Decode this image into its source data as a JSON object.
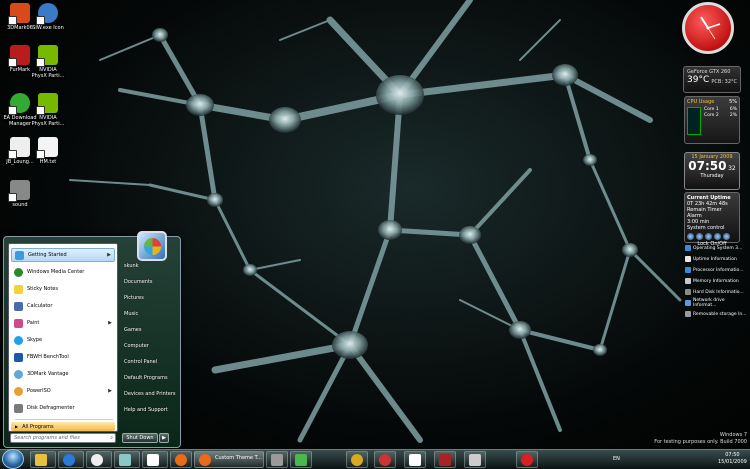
{
  "desktop": {
    "icons": [
      {
        "label": "3DMark06",
        "color": "#d84a1a"
      },
      {
        "label": "SIW.exe Icon",
        "color": "#3a7ac8"
      },
      {
        "label": "FurMark",
        "color": "#b81c1c"
      },
      {
        "label": "NVIDIA PhysX Parti...",
        "color": "#76b900"
      },
      {
        "label": "EA Download Manager",
        "color": "#33aa33"
      },
      {
        "label": "NVIDIA PhysX Parti...",
        "color": "#76b900"
      },
      {
        "label": "JB_Loung...",
        "color": "#eeeeee"
      },
      {
        "label": "HM.txt",
        "color": "#f4f4f4"
      },
      {
        "label": "sound",
        "color": "#888888"
      }
    ]
  },
  "start_menu": {
    "left_items": [
      {
        "label": "Getting Started",
        "color": "#3a9be0",
        "arrow": "▶",
        "highlighted": true
      },
      {
        "label": "Windows Media Center",
        "color": "#2a8a2a",
        "arrow": ""
      },
      {
        "label": "Sticky Notes",
        "color": "#f2d338",
        "arrow": ""
      },
      {
        "label": "Calculator",
        "color": "#4a6aa8",
        "arrow": ""
      },
      {
        "label": "Paint",
        "color": "#d04a8a",
        "arrow": "▶"
      },
      {
        "label": "Skype",
        "color": "#20a0e8",
        "arrow": ""
      },
      {
        "label": "FBWH BenchTool",
        "color": "#1a5aa8",
        "arrow": ""
      },
      {
        "label": "3DMark Vantage",
        "color": "#60a8d8",
        "arrow": ""
      },
      {
        "label": "PowerISO",
        "color": "#e8a030",
        "arrow": "▶"
      },
      {
        "label": "Disk Defragmenter",
        "color": "#7a7a7a",
        "arrow": ""
      }
    ],
    "all_programs": "All Programs",
    "all_programs_arrow": "▶",
    "search_placeholder": "Search programs and files",
    "search_icon": "search-icon",
    "right_items": [
      "skunk",
      "Documents",
      "Pictures",
      "Music",
      "Games",
      "Computer",
      "Control Panel",
      "Default Programs",
      "Devices and Printers",
      "Help and Support"
    ],
    "shutdown_label": "Shut Down",
    "shutdown_arrow": "▶"
  },
  "gadgets": {
    "gpu": {
      "title": "GeForce GTX 260",
      "temp": "39°C",
      "pcb": "PCB: 32°C"
    },
    "cpu": {
      "title": "CPU Usage",
      "percent": "5%",
      "core1": "Core 1",
      "core2": "Core 2",
      "core1_val": "6%",
      "core2_val": "2%"
    },
    "calendar": {
      "date": "15 January 2009",
      "time": "07:50",
      "seconds": "32",
      "day": "Thursday"
    },
    "uptime": {
      "title": "Current Uptime",
      "value": "0T 23h 42m 48s",
      "row2": "Remain  Timer  Alarm",
      "row3": "3:00 min",
      "row4": "System control",
      "lock": "Lock On/Off"
    },
    "links": [
      {
        "label": "Operating System 3...",
        "color": "#3a8ad8"
      },
      {
        "label": "Uptime Information",
        "color": "#e8e8e8"
      },
      {
        "label": "Processor Informatio...",
        "color": "#3a8ad8"
      },
      {
        "label": "Memory Information",
        "color": "#c8c8c8"
      },
      {
        "label": "Hard Disk Informatio...",
        "color": "#8a8a8a"
      },
      {
        "label": "Network drive Informat...",
        "color": "#5a9ad8"
      },
      {
        "label": "Removable storage In...",
        "color": "#9a9a9a"
      }
    ]
  },
  "taskbar": {
    "buttons": [
      {
        "name": "explorer",
        "color": "#e8c040"
      },
      {
        "name": "media-player",
        "color": "#2a7ad8"
      },
      {
        "name": "fan",
        "color": "#eeeeee"
      },
      {
        "name": "network",
        "color": "#8ac8c8"
      },
      {
        "name": "calendar",
        "color": "#ffffff"
      }
    ],
    "active_label": "Custom Theme T...",
    "extra_buttons": [
      {
        "name": "app-a",
        "color": "#9a9a9a"
      },
      {
        "name": "app-b",
        "color": "#4ab84a"
      },
      {
        "name": "app-c",
        "color": "#d8a820"
      },
      {
        "name": "app-d",
        "color": "#cc3333"
      },
      {
        "name": "app-e",
        "color": "#ffffff"
      },
      {
        "name": "app-f",
        "color": "#aa2222"
      },
      {
        "name": "app-g",
        "color": "#cccccc"
      },
      {
        "name": "app-h",
        "color": "#d82020"
      }
    ],
    "tray": {
      "language": "EN",
      "time": "07:50",
      "date": "15/01/2009"
    }
  },
  "watermark": {
    "line1": "Windows 7",
    "line2": "For testing purposes only. Build 7000"
  }
}
